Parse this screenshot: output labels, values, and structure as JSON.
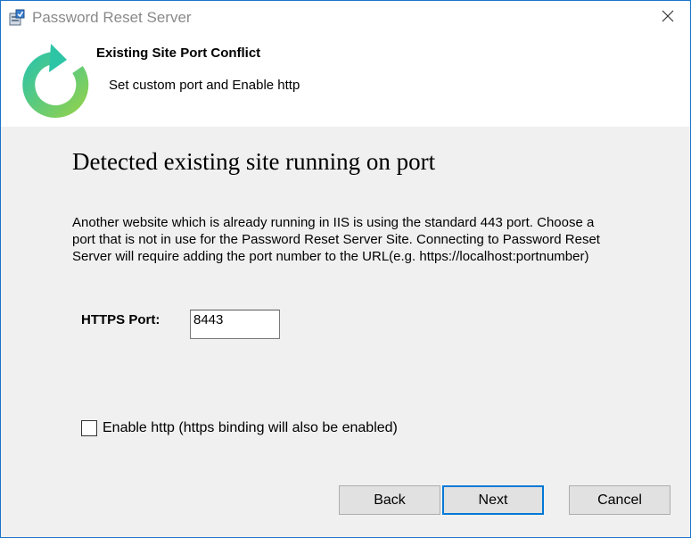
{
  "window": {
    "title": "Password Reset Server"
  },
  "banner": {
    "title": "Existing Site Port Conflict",
    "subtitle": "Set custom port and Enable http"
  },
  "main": {
    "heading": "Detected existing site running on port",
    "description": "Another website which is already running in IIS is using the standard 443 port. Choose a port that is not in use for the Password Reset Server Site. Connecting to Password Reset Server will require adding the port number to the URL(e.g. https://localhost:portnumber)",
    "port_label": "HTTPS Port:",
    "port_value": "8443",
    "enable_http_label": "Enable http (https binding will also be enabled)",
    "enable_http_checked": false
  },
  "buttons": {
    "back": "Back",
    "next": "Next",
    "cancel": "Cancel"
  },
  "icons": {
    "app": "installer-icon",
    "close": "close-icon",
    "logo": "refresh-circle-logo"
  },
  "colors": {
    "window_border": "#1a74c9",
    "primary_button_border": "#0078d7",
    "logo_green": "#3fbf4f"
  }
}
